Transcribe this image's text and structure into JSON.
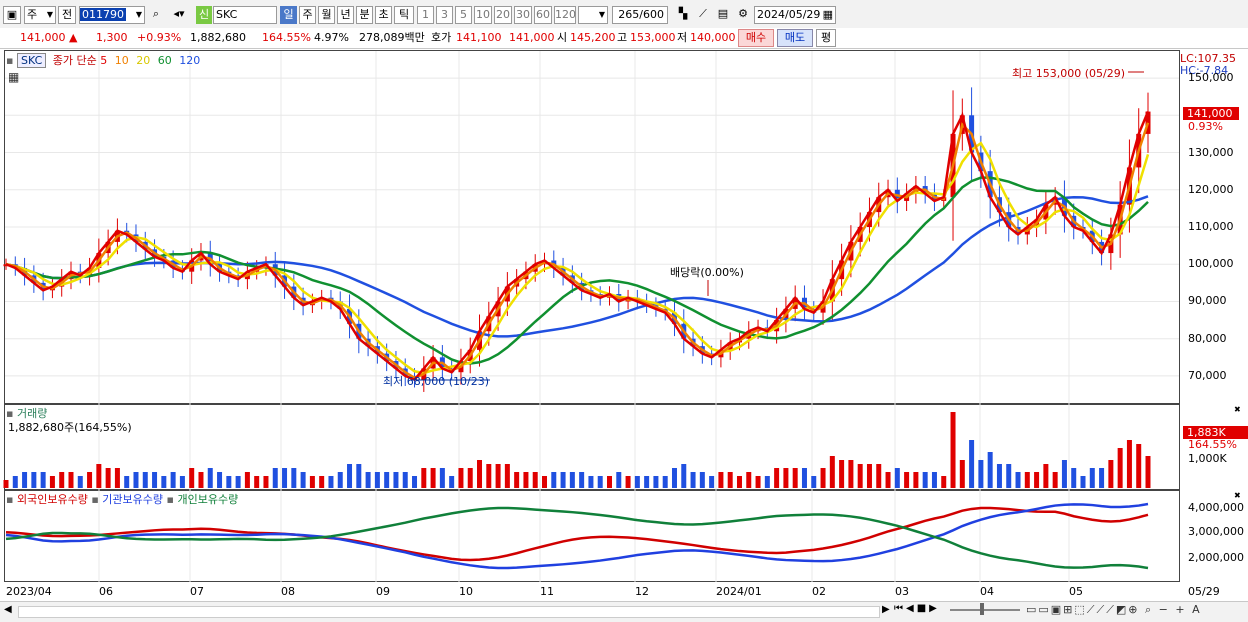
{
  "toolbar": {
    "type_select": "주",
    "prev_label": "전",
    "code": "011790",
    "stock_name": "SKC",
    "credit_badge": "신",
    "periods": [
      "일",
      "주",
      "월",
      "년",
      "분",
      "초",
      "틱"
    ],
    "intervals": [
      "1",
      "3",
      "5",
      "10",
      "20",
      "30",
      "60",
      "120"
    ],
    "count": "265",
    "count_max": "/600",
    "date": "2024/05/29"
  },
  "quote": {
    "price": "141,000",
    "change": "1,300",
    "change_pct": "+0.93%",
    "volume": "1,882,680",
    "vol_ratio": "164.55%",
    "turnover": "4.97%",
    "amount": "278,089백만",
    "bid_label": "호가",
    "bid": "141,100",
    "ask": "141,000",
    "open_label": "시",
    "open": "145,200",
    "high_label": "고",
    "high": "153,000",
    "low_label": "저",
    "low": "140,000",
    "buy_label": "매수",
    "sell_label": "매도",
    "avg_label": "평"
  },
  "price_panel": {
    "symbol": "SKC",
    "ma_title": "종가 단순",
    "ma_periods": [
      "5",
      "10",
      "20",
      "60",
      "120"
    ],
    "ma_colors": [
      "#e00000",
      "#f08000",
      "#f0e000",
      "#109030",
      "#2050e0"
    ],
    "lc": "LC:107.35",
    "hc": "HC:-7.84",
    "high_note": "최고 153,000 (05/29)",
    "low_note": "최저 68,000 (10/23)",
    "dividend_note": "배당락(0.00%)",
    "current_price": "141,000",
    "current_pct": "0.93%",
    "yticks": [
      "150,000",
      "140,000",
      "130,000",
      "120,000",
      "110,000",
      "100,000",
      "90,000",
      "80,000",
      "70,000"
    ]
  },
  "volume_panel": {
    "title": "거래량",
    "value": "1,882,680주(164,55%)",
    "current": "1,883K",
    "current_pct": "164.55%",
    "ytick": "1,000K"
  },
  "holding_panel": {
    "legend": [
      "외국인보유수량",
      "기관보유수량",
      "개인보유수량"
    ],
    "legend_colors": [
      "#d00000",
      "#2040e0",
      "#10803a"
    ],
    "yticks": [
      "4,000,000",
      "3,000,000",
      "2,000,000"
    ]
  },
  "x_labels": [
    "2023/04",
    "06",
    "07",
    "08",
    "09",
    "10",
    "11",
    "12",
    "2024/01",
    "02",
    "03",
    "04",
    "05",
    "05/29"
  ],
  "chart_data": {
    "type": "line",
    "title": "SKC",
    "ylim": [
      63000,
      157000
    ],
    "series": [
      {
        "name": "종가",
        "values": [
          100000,
          99000,
          97000,
          95000,
          93000,
          94000,
          96000,
          98000,
          97000,
          99000,
          103000,
          106000,
          109000,
          108000,
          106000,
          104000,
          102000,
          101000,
          99000,
          98000,
          101000,
          103000,
          100000,
          98000,
          97000,
          96000,
          98000,
          99000,
          100000,
          97000,
          94000,
          91000,
          89000,
          90000,
          91000,
          90000,
          88000,
          84000,
          80000,
          78000,
          76000,
          74000,
          72000,
          70000,
          69000,
          72000,
          75000,
          72000,
          71000,
          74000,
          77000,
          82000,
          86000,
          90000,
          94000,
          96000,
          98000,
          100000,
          101000,
          99000,
          97000,
          95000,
          93000,
          92000,
          91000,
          92000,
          90000,
          91000,
          90000,
          89000,
          88000,
          87000,
          84000,
          80000,
          78000,
          76000,
          75000,
          77000,
          79000,
          80000,
          82000,
          83000,
          82000,
          85000,
          88000,
          91000,
          88000,
          87000,
          90000,
          96000,
          101000,
          106000,
          110000,
          114000,
          118000,
          120000,
          117000,
          119000,
          121000,
          119000,
          117000,
          118000,
          135000,
          140000,
          130000,
          125000,
          118000,
          114000,
          110000,
          108000,
          110000,
          112000,
          116000,
          118000,
          113000,
          110000,
          109000,
          106000,
          103000,
          108000,
          116000,
          126000,
          135000,
          141000
        ]
      }
    ]
  }
}
